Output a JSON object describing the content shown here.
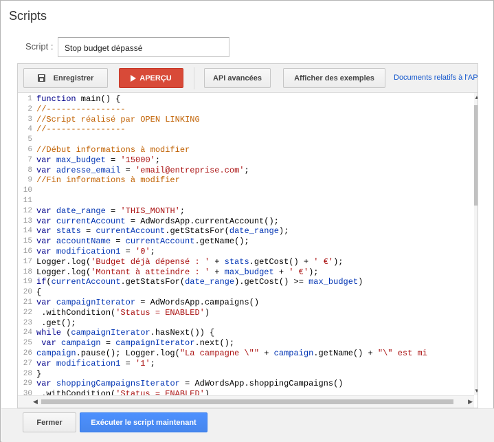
{
  "dialog": {
    "title": "Scripts",
    "script_label": "Script :",
    "script_name": "Stop budget dépassé"
  },
  "toolbar": {
    "save_label": "Enregistrer",
    "preview_label": "APERÇU",
    "api_label": "API avancées",
    "examples_label": "Afficher des exemples",
    "docs_link": "Documents relatifs à l'API"
  },
  "code": {
    "lines": [
      {
        "n": "1",
        "tokens": [
          [
            "k",
            "function"
          ],
          [
            "p",
            " main() {"
          ]
        ]
      },
      {
        "n": "2",
        "tokens": [
          [
            "c",
            "//----------------"
          ]
        ]
      },
      {
        "n": "3",
        "tokens": [
          [
            "c",
            "//Script réalisé par OPEN LINKING"
          ]
        ]
      },
      {
        "n": "4",
        "tokens": [
          [
            "c",
            "//----------------"
          ]
        ]
      },
      {
        "n": "5",
        "tokens": []
      },
      {
        "n": "6",
        "tokens": [
          [
            "c",
            "//Début informations à modifier"
          ]
        ]
      },
      {
        "n": "7",
        "tokens": [
          [
            "k",
            "var"
          ],
          [
            "p",
            " "
          ],
          [
            "v",
            "max_budget"
          ],
          [
            "p",
            " = "
          ],
          [
            "s",
            "'15000'"
          ],
          [
            "p",
            ";"
          ]
        ]
      },
      {
        "n": "8",
        "tokens": [
          [
            "k",
            "var"
          ],
          [
            "p",
            " "
          ],
          [
            "v",
            "adresse_email"
          ],
          [
            "p",
            " = "
          ],
          [
            "s",
            "'email@entreprise.com'"
          ],
          [
            "p",
            ";"
          ]
        ]
      },
      {
        "n": "9",
        "tokens": [
          [
            "c",
            "//Fin informations à modifier"
          ]
        ]
      },
      {
        "n": "10",
        "tokens": []
      },
      {
        "n": "11",
        "tokens": []
      },
      {
        "n": "12",
        "tokens": [
          [
            "k",
            "var"
          ],
          [
            "p",
            " "
          ],
          [
            "v",
            "date_range"
          ],
          [
            "p",
            " = "
          ],
          [
            "s",
            "'THIS_MONTH'"
          ],
          [
            "p",
            ";"
          ]
        ]
      },
      {
        "n": "13",
        "tokens": [
          [
            "k",
            "var"
          ],
          [
            "p",
            " "
          ],
          [
            "v",
            "currentAccount"
          ],
          [
            "p",
            " = AdWordsApp.currentAccount();"
          ]
        ]
      },
      {
        "n": "14",
        "tokens": [
          [
            "k",
            "var"
          ],
          [
            "p",
            " "
          ],
          [
            "v",
            "stats"
          ],
          [
            "p",
            " = "
          ],
          [
            "v",
            "currentAccount"
          ],
          [
            "p",
            ".getStatsFor("
          ],
          [
            "v",
            "date_range"
          ],
          [
            "p",
            ");"
          ]
        ]
      },
      {
        "n": "15",
        "tokens": [
          [
            "k",
            "var"
          ],
          [
            "p",
            " "
          ],
          [
            "v",
            "accountName"
          ],
          [
            "p",
            " = "
          ],
          [
            "v",
            "currentAccount"
          ],
          [
            "p",
            ".getName();"
          ]
        ]
      },
      {
        "n": "16",
        "tokens": [
          [
            "k",
            "var"
          ],
          [
            "p",
            " "
          ],
          [
            "v",
            "modification1"
          ],
          [
            "p",
            " = "
          ],
          [
            "s",
            "'0'"
          ],
          [
            "p",
            ";"
          ]
        ]
      },
      {
        "n": "17",
        "tokens": [
          [
            "p",
            "Logger.log("
          ],
          [
            "s",
            "'Budget déjà dépensé : '"
          ],
          [
            "p",
            " + "
          ],
          [
            "v",
            "stats"
          ],
          [
            "p",
            ".getCost() + "
          ],
          [
            "s",
            "' €'"
          ],
          [
            "p",
            ");"
          ]
        ]
      },
      {
        "n": "18",
        "tokens": [
          [
            "p",
            "Logger.log("
          ],
          [
            "s",
            "'Montant à atteindre : '"
          ],
          [
            "p",
            " + "
          ],
          [
            "v",
            "max_budget"
          ],
          [
            "p",
            " + "
          ],
          [
            "s",
            "' €'"
          ],
          [
            "p",
            ");"
          ]
        ]
      },
      {
        "n": "19",
        "tokens": [
          [
            "k",
            "if"
          ],
          [
            "p",
            "("
          ],
          [
            "v",
            "currentAccount"
          ],
          [
            "p",
            ".getStatsFor("
          ],
          [
            "v",
            "date_range"
          ],
          [
            "p",
            ").getCost() >= "
          ],
          [
            "v",
            "max_budget"
          ],
          [
            "p",
            ")"
          ]
        ]
      },
      {
        "n": "20",
        "tokens": [
          [
            "p",
            "{"
          ]
        ]
      },
      {
        "n": "21",
        "tokens": [
          [
            "k",
            "var"
          ],
          [
            "p",
            " "
          ],
          [
            "v",
            "campaignIterator"
          ],
          [
            "p",
            " = AdWordsApp.campaigns()"
          ]
        ]
      },
      {
        "n": "22",
        "tokens": [
          [
            "p",
            " .withCondition("
          ],
          [
            "s",
            "'Status = ENABLED'"
          ],
          [
            "p",
            ")"
          ]
        ]
      },
      {
        "n": "23",
        "tokens": [
          [
            "p",
            " .get();"
          ]
        ]
      },
      {
        "n": "24",
        "tokens": [
          [
            "k",
            "while"
          ],
          [
            "p",
            " ("
          ],
          [
            "v",
            "campaignIterator"
          ],
          [
            "p",
            ".hasNext()) {"
          ]
        ]
      },
      {
        "n": "25",
        "tokens": [
          [
            "p",
            " "
          ],
          [
            "k",
            "var"
          ],
          [
            "p",
            " "
          ],
          [
            "v",
            "campaign"
          ],
          [
            "p",
            " = "
          ],
          [
            "v",
            "campaignIterator"
          ],
          [
            "p",
            ".next();"
          ]
        ]
      },
      {
        "n": "26",
        "tokens": [
          [
            "v",
            "campaign"
          ],
          [
            "p",
            ".pause(); Logger.log("
          ],
          [
            "s",
            "\"La campagne \\\"\""
          ],
          [
            "p",
            " + "
          ],
          [
            "v",
            "campaign"
          ],
          [
            "p",
            ".getName() + "
          ],
          [
            "s",
            "\"\\\" est mi"
          ]
        ]
      },
      {
        "n": "27",
        "tokens": [
          [
            "k",
            "var"
          ],
          [
            "p",
            " "
          ],
          [
            "v",
            "modification1"
          ],
          [
            "p",
            " = "
          ],
          [
            "s",
            "'1'"
          ],
          [
            "p",
            ";"
          ]
        ]
      },
      {
        "n": "28",
        "tokens": [
          [
            "p",
            "}"
          ]
        ]
      },
      {
        "n": "29",
        "tokens": [
          [
            "k",
            "var"
          ],
          [
            "p",
            " "
          ],
          [
            "v",
            "shoppingCampaignsIterator"
          ],
          [
            "p",
            " = AdWordsApp.shoppingCampaigns()"
          ]
        ]
      },
      {
        "n": "30",
        "tokens": [
          [
            "p",
            " .withCondition("
          ],
          [
            "s",
            "'Status = ENABLED'"
          ],
          [
            "p",
            ")"
          ]
        ]
      }
    ]
  },
  "footer": {
    "close_label": "Fermer",
    "run_label": "Exécuter le script maintenant"
  },
  "colors": {
    "preview_bg": "#d84a38",
    "run_bg": "#4d90fe",
    "link": "#1155cc",
    "keyword": "#00008b",
    "comment": "#c06000",
    "string": "#aa1111",
    "identifier": "#0033b3"
  }
}
